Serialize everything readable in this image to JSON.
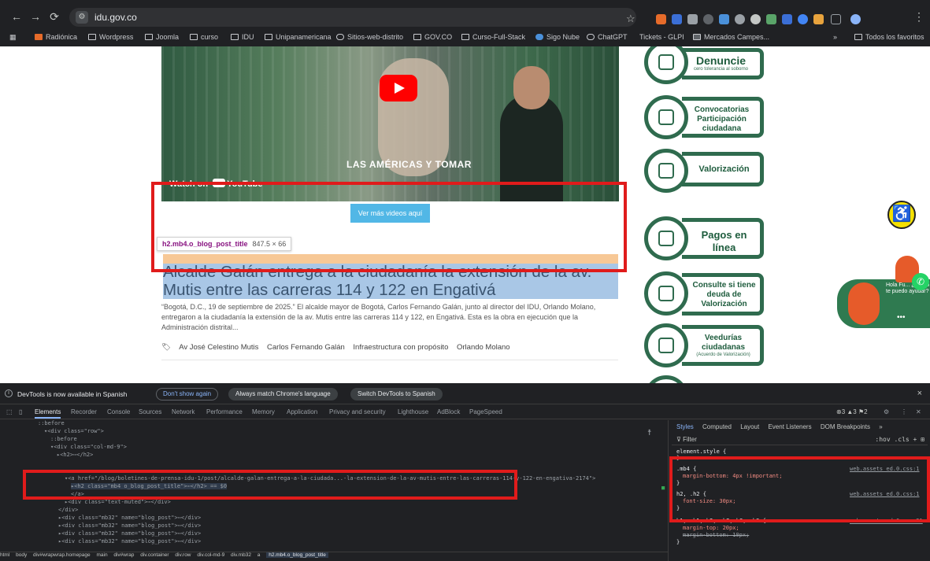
{
  "browser": {
    "url": "idu.gov.co",
    "nav": {
      "back": "←",
      "forward": "→",
      "reload": "⟳"
    },
    "bookmarks": [
      "Radiónica",
      "Wordpress",
      "Joomla",
      "curso",
      "IDU",
      "Unipanamericana",
      "Sitios-web-distrito",
      "GOV.CO",
      "Curso-Full-Stack",
      "Sigo Nube",
      "ChatGPT",
      "Tickets - GLPI",
      "Mercados Campes..."
    ],
    "bookmarks_overflow": "»",
    "all_bookmarks": "Todos los favoritos",
    "colors": {
      "chrome": "#202124",
      "omnibox": "#303134"
    }
  },
  "page": {
    "video": {
      "overlay_text": "LAS AMÉRICAS Y TOMAR",
      "watch_on": "Watch on",
      "youtube_label": "YouTube",
      "play_icon": "youtube-play-icon"
    },
    "more_videos_button": "Ver más videos aquí",
    "inspect_badge": {
      "selector": "h2.mb4.o_blog_post_title",
      "size": "847.5 × 66"
    },
    "post_title": "Alcalde Galán entrega a la ciudadanía la extensión de la av. Mutis entre las carreras 114 y 122 en Engativá",
    "excerpt": "“Bogotá, D.C., 19 de septiembre de 2025.” El alcalde mayor de Bogotá, Carlos Fernando Galán, junto al director del IDU, Orlando Molano, entregaron a la ciudadanía la extensión de la av. Mutis entre las carreras 114 y 122, en Engativá. Esta es la obra en ejecución que la Administración distrital...",
    "tags": [
      "Av José Celestino Mutis",
      "Carlos Fernando Galán",
      "Infraestructura con propósito",
      "Orlando Molano"
    ],
    "side_banners": [
      {
        "title": "Denuncie",
        "sub": "cero tolerancia al soborno"
      },
      {
        "title": "Convocatorias Participación ciudadana",
        "sub": ""
      },
      {
        "title": "Valorización",
        "sub": ""
      },
      {
        "title": "Pagos en línea",
        "sub": ""
      },
      {
        "title": "Consulte si tiene deuda de Valorización",
        "sub": ""
      },
      {
        "title": "Veedurías ciudadanas",
        "sub": "(Acuerdo de Valorización)"
      }
    ],
    "chat_widget": {
      "message": "Hola Fu... ¿Cómo te puedo ayudar?",
      "dots": "•••"
    },
    "accessibility_icon": "accessibility-icon",
    "colors": {
      "accent_green": "#2f6b4e",
      "highlight_red": "#e01b1b",
      "button_blue": "#51b7e6"
    }
  },
  "devtools": {
    "notice": {
      "text": "DevTools is now available in Spanish",
      "dont_show": "Don't show again",
      "always_match": "Always match Chrome's language",
      "switch": "Switch DevTools to Spanish",
      "close": "×"
    },
    "tabs": [
      "Elements",
      "Recorder",
      "Console",
      "Sources",
      "Network",
      "Performance",
      "Memory",
      "Application",
      "Privacy and security",
      "Lighthouse",
      "AdBlock",
      "PageSpeed"
    ],
    "counts": "⊗3 ▲3 ⚑2",
    "dom_lines": [
      "::before",
      "▾<div class=\"row\">",
      "::before",
      "▾<div class=\"col-md-9\">",
      "▸<h2>⋯</h2>",
      "",
      "▾<a href=\"/blog/boletines-de-prensa-idu-1/post/alcalde-galan-entrega-a-la-ciudada...-la-extension-de-la-av-mutis-entre-las-carreras-114-y-122-en-engativa-2174\">",
      "▸<h2 class=\"mb4 o_blog_post_title\">⋯</h2> == $0",
      "</a>",
      "▸<div class=\"text-muted\">⋯</div>",
      "</div>",
      "▸<div class=\"mb32\" name=\"blog_post\">⋯</div>",
      "▸<div class=\"mb32\" name=\"blog_post\">⋯</div>",
      "▸<div class=\"mb32\" name=\"blog_post\">⋯</div>",
      "▸<div class=\"mb32\" name=\"blog_post\">⋯</div>"
    ],
    "breadcrumbs": [
      "html",
      "body",
      "div#wrapwrap.homepage",
      "main",
      "div#wrap",
      "div.container",
      "div.row",
      "div.col-md-9",
      "div.mb32",
      "a",
      "h2.mb4.o_blog_post_title"
    ],
    "styles_tabs": [
      "Styles",
      "Computed",
      "Layout",
      "Event Listeners",
      "DOM Breakpoints",
      "»"
    ],
    "filter_placeholder": "Filter",
    "filter_tools": ":hov .cls + ⊞",
    "rules": {
      "element_style": "element.style {",
      "r1_selector": ".mb4 {",
      "r1_prop": "margin-bottom: 4px !important;",
      "r1_src": "web.assets_ed.0.css:1",
      "r2_selector": "h2, .h2 {",
      "r2_prop": "font-size: 30px;",
      "r2_src": "web.assets_ed.0.css:1",
      "r3_selector": "h1, .h1, h2, .h2, h3, .h3 {",
      "r3_prop1": "margin-top: 20px;",
      "r3_prop2": "margin-bottom: 10px;",
      "r3_src": "web.assets_ed.0.css:21"
    }
  }
}
